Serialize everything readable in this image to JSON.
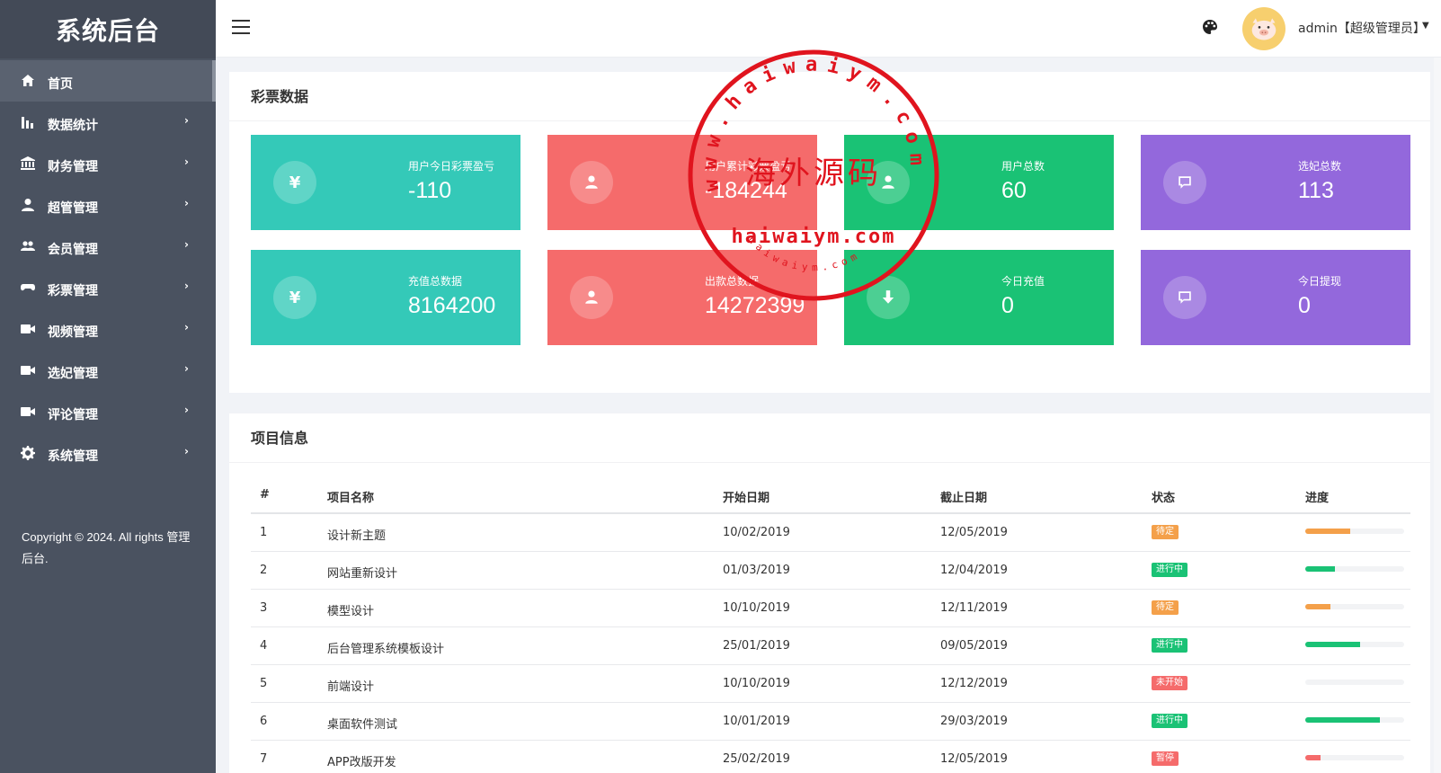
{
  "sidebar": {
    "brand": "系统后台",
    "items": [
      {
        "label": "首页",
        "icon": "home-icon",
        "active": true,
        "arrow": ""
      },
      {
        "label": "数据统计",
        "icon": "bar-chart-icon",
        "arrow": "›"
      },
      {
        "label": "财务管理",
        "icon": "bank-icon",
        "arrow": "›"
      },
      {
        "label": "超管管理",
        "icon": "user-icon",
        "arrow": "›"
      },
      {
        "label": "会员管理",
        "icon": "users-icon",
        "arrow": "›"
      },
      {
        "label": "彩票管理",
        "icon": "gamepad-icon",
        "arrow": "›"
      },
      {
        "label": "视频管理",
        "icon": "video-icon",
        "arrow": "›"
      },
      {
        "label": "选妃管理",
        "icon": "video-icon",
        "arrow": "›"
      },
      {
        "label": "评论管理",
        "icon": "video-icon",
        "arrow": "›"
      },
      {
        "label": "系统管理",
        "icon": "gear-icon",
        "arrow": "›"
      }
    ],
    "copyright": "Copyright © 2024. All rights 管理后台."
  },
  "header": {
    "user": "admin【超级管理员】",
    "caret": "▼"
  },
  "lottery": {
    "title": "彩票数据",
    "cards": [
      {
        "label": "用户今日彩票盈亏",
        "value": "-110",
        "icon": "yen-icon",
        "color": "#34c9b8"
      },
      {
        "label": "用户累计彩票盈亏",
        "value": "-184244",
        "icon": "user-icon",
        "color": "#f56b6b"
      },
      {
        "label": "用户总数",
        "value": "60",
        "icon": "user-icon",
        "color": "#1ac275"
      },
      {
        "label": "选妃总数",
        "value": "113",
        "icon": "comment-icon",
        "color": "#9368dc"
      },
      {
        "label": "充值总数据",
        "value": "8164200",
        "icon": "yen-icon",
        "color": "#34c9b8"
      },
      {
        "label": "出款总数据",
        "value": "14272399",
        "icon": "user-icon",
        "color": "#f56b6b"
      },
      {
        "label": "今日充值",
        "value": "0",
        "icon": "download-icon",
        "color": "#1ac275"
      },
      {
        "label": "今日提现",
        "value": "0",
        "icon": "comment-icon",
        "color": "#9368dc"
      }
    ],
    "yen": "¥"
  },
  "project": {
    "title": "项目信息",
    "headers": [
      "#",
      "项目名称",
      "开始日期",
      "截止日期",
      "状态",
      "进度"
    ],
    "rows": [
      {
        "no": "1",
        "name": "设计新主题",
        "start": "10/02/2019",
        "end": "12/05/2019",
        "status": "待定",
        "status_color": "#f4a04a",
        "progress": 45,
        "bar_color": "#f4a04a"
      },
      {
        "no": "2",
        "name": "网站重新设计",
        "start": "01/03/2019",
        "end": "12/04/2019",
        "status": "进行中",
        "status_color": "#1ac275",
        "progress": 30,
        "bar_color": "#1ac275"
      },
      {
        "no": "3",
        "name": "模型设计",
        "start": "10/10/2019",
        "end": "12/11/2019",
        "status": "待定",
        "status_color": "#f4a04a",
        "progress": 25,
        "bar_color": "#f4a04a"
      },
      {
        "no": "4",
        "name": "后台管理系统模板设计",
        "start": "25/01/2019",
        "end": "09/05/2019",
        "status": "进行中",
        "status_color": "#1ac275",
        "progress": 55,
        "bar_color": "#1ac275"
      },
      {
        "no": "5",
        "name": "前端设计",
        "start": "10/10/2019",
        "end": "12/12/2019",
        "status": "未开始",
        "status_color": "#f56b6b",
        "progress": 0,
        "bar_color": "#f56b6b"
      },
      {
        "no": "6",
        "name": "桌面软件测试",
        "start": "10/01/2019",
        "end": "29/03/2019",
        "status": "进行中",
        "status_color": "#1ac275",
        "progress": 75,
        "bar_color": "#1ac275"
      },
      {
        "no": "7",
        "name": "APP改版开发",
        "start": "25/02/2019",
        "end": "12/05/2019",
        "status": "暂停",
        "status_color": "#f56b6b",
        "progress": 15,
        "bar_color": "#f56b6b"
      }
    ]
  },
  "watermark": {
    "top_arc": "www.haiwaiym.com",
    "center": "海外源码",
    "bottom_text": "haiwaiym.com",
    "bottom_arc": "haiwaiym.com"
  }
}
